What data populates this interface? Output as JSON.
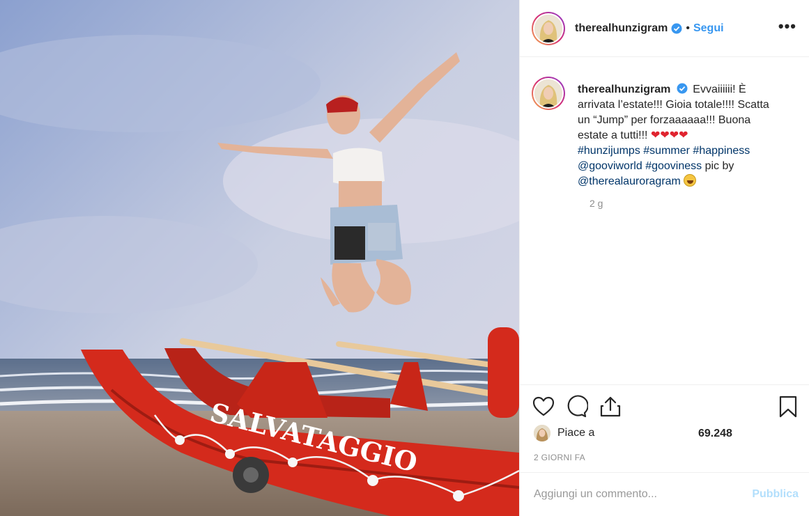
{
  "post": {
    "username": "therealhunzigram",
    "follow_label": "Segui",
    "dot": "•",
    "more_label": "•••",
    "caption": {
      "username": "therealhunzigram",
      "text_1": "Evvaiiiiii! È arrivata l’estate!!! Gioia totale!!!! Scatta un “Jump” per forzaaaaaa!!! Buona estate a tutti!!! ",
      "hearts": "❤❤❤❤",
      "hashtags": [
        "#hunzijumps",
        "#summer",
        "#happiness"
      ],
      "mentions_line": [
        "@gooviworld",
        "#gooviness"
      ],
      "pic_by": "pic by",
      "photographer": "@therealauroragram"
    },
    "caption_time": "2 g",
    "likes_label": "Piace a",
    "likes_count": "69.248",
    "posted_ago": "2 GIORNI FA",
    "comment_placeholder": "Aggiungi un commento...",
    "publish_label": "Pubblica",
    "photo_text": "SALVATAGGIO"
  },
  "colors": {
    "link_blue": "#3897f0",
    "hashtag": "#003569",
    "boat_red": "#d42a1c",
    "publish_disabled": "#b2dffc"
  },
  "icons": [
    "verified-badge-icon",
    "more-options-icon",
    "heart-icon",
    "comment-icon",
    "share-icon",
    "bookmark-icon"
  ]
}
